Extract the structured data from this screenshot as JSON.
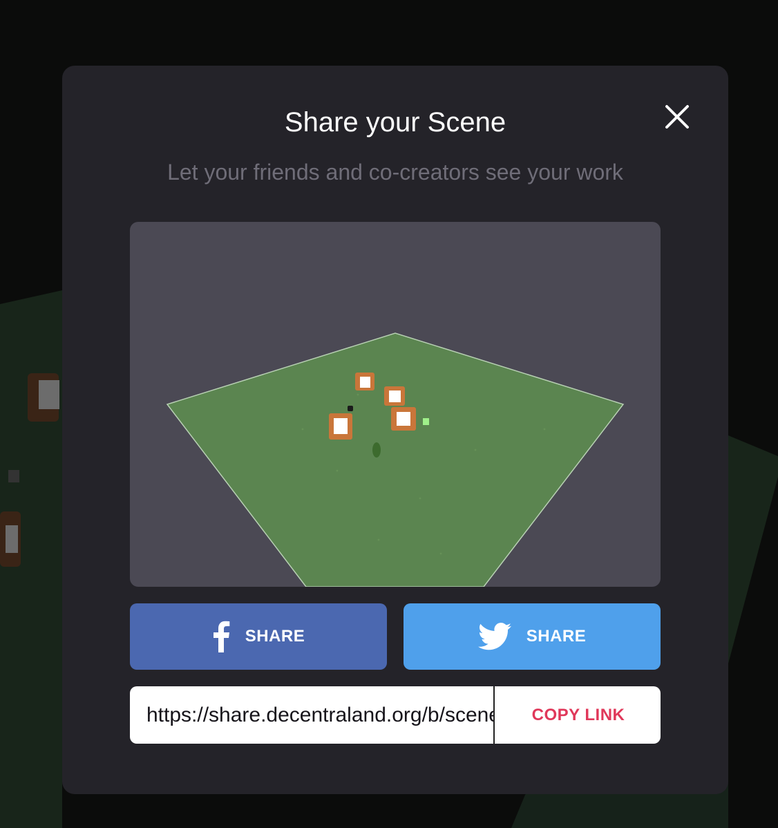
{
  "modal": {
    "title": "Share your Scene",
    "subtitle": "Let your friends and co-creators see your work"
  },
  "buttons": {
    "facebook_label": "SHARE",
    "twitter_label": "SHARE",
    "copy_link_label": "COPY LINK"
  },
  "link": {
    "url": "https://share.decentraland.org/b/scene"
  },
  "icons": {
    "close": "close-icon",
    "facebook": "facebook-icon",
    "twitter": "twitter-icon"
  },
  "colors": {
    "modal_bg": "#242329",
    "facebook": "#4b68b0",
    "twitter": "#4fa0eb",
    "copy_link": "#e0385a",
    "subtitle": "#6f6d78"
  }
}
